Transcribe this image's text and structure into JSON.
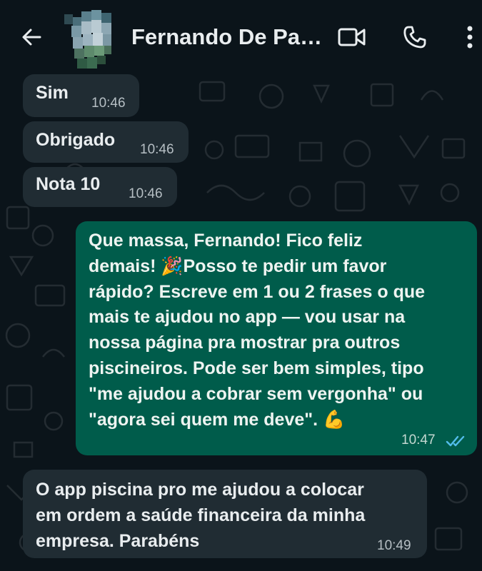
{
  "header": {
    "contact_name": "Fernando De Pau…",
    "back_icon": "arrow-left-icon",
    "video_icon": "video-camera-icon",
    "call_icon": "phone-icon",
    "menu_icon": "more-vertical-icon"
  },
  "colors": {
    "background": "#0b141a",
    "incoming_bubble": "#202c33",
    "outgoing_bubble": "#005c4b",
    "read_ticks": "#53bdeb",
    "text": "#e9edef"
  },
  "messages": [
    {
      "direction": "incoming",
      "text": "Sim",
      "time": "10:46"
    },
    {
      "direction": "incoming",
      "text": "Obrigado",
      "time": "10:46"
    },
    {
      "direction": "incoming",
      "text": "Nota 10",
      "time": "10:46"
    },
    {
      "direction": "outgoing",
      "lines": [
        "Que massa, Fernando! Fico feliz",
        "demais! 🎉Posso te pedir um favor",
        "rápido? Escreve em 1 ou 2 frases o que",
        "mais te ajudou no app — vou usar na",
        "nossa página pra mostrar pra outros",
        "piscineiros. Pode ser bem simples, tipo",
        "\"me ajudou a cobrar sem vergonha\" ou",
        "\"agora sei quem me deve\". 💪"
      ],
      "time": "10:47",
      "status": "read"
    },
    {
      "direction": "incoming",
      "lines": [
        "O app piscina pro me ajudou a colocar",
        "em ordem a saúde financeira da minha",
        "empresa. Parabéns"
      ],
      "time": "10:49"
    }
  ]
}
